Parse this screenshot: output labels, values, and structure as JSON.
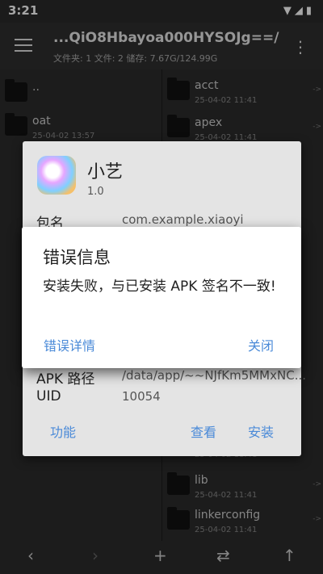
{
  "status": {
    "time": "3:21",
    "icons": "▼◢▮"
  },
  "toolbar": {
    "path": "...QiO8Hbayoa000HYSOJg==/",
    "stats": "文件夹: 1  文件: 2  储存: 7.67G/124.99G"
  },
  "left_pane": [
    {
      "name": "..",
      "date": ""
    },
    {
      "name": "oat",
      "date": "25-04-02 13:57"
    }
  ],
  "right_pane": [
    {
      "name": "acct",
      "date": "25-04-02 11:41"
    },
    {
      "name": "apex",
      "date": "25-04-02 11:41"
    },
    {
      "name": "",
      "date": "25-04-02 11:41"
    },
    {
      "name": "lib",
      "date": "25-04-02 11:41"
    },
    {
      "name": "linkerconfig",
      "date": "25-04-02 11:41"
    }
  ],
  "app_info": {
    "name": "小艺",
    "version": "1.0",
    "package_label": "包名",
    "package_value": "com.example.xiaoyi",
    "apk_path_label": "APK 路径",
    "apk_path_value": "/data/app/~~NJfKm5MMxNC...",
    "uid_label": "UID",
    "uid_value": "10054",
    "btn_functions": "功能",
    "btn_view": "查看",
    "btn_install": "安装"
  },
  "error_dialog": {
    "title": "错误信息",
    "message": "安装失败，与已安装 APK 签名不一致!",
    "btn_details": "错误详情",
    "btn_close": "关闭"
  },
  "bottom_bar": {
    "back": "‹",
    "forward": "›",
    "add": "+",
    "swap": "⇄",
    "up": "↑"
  }
}
